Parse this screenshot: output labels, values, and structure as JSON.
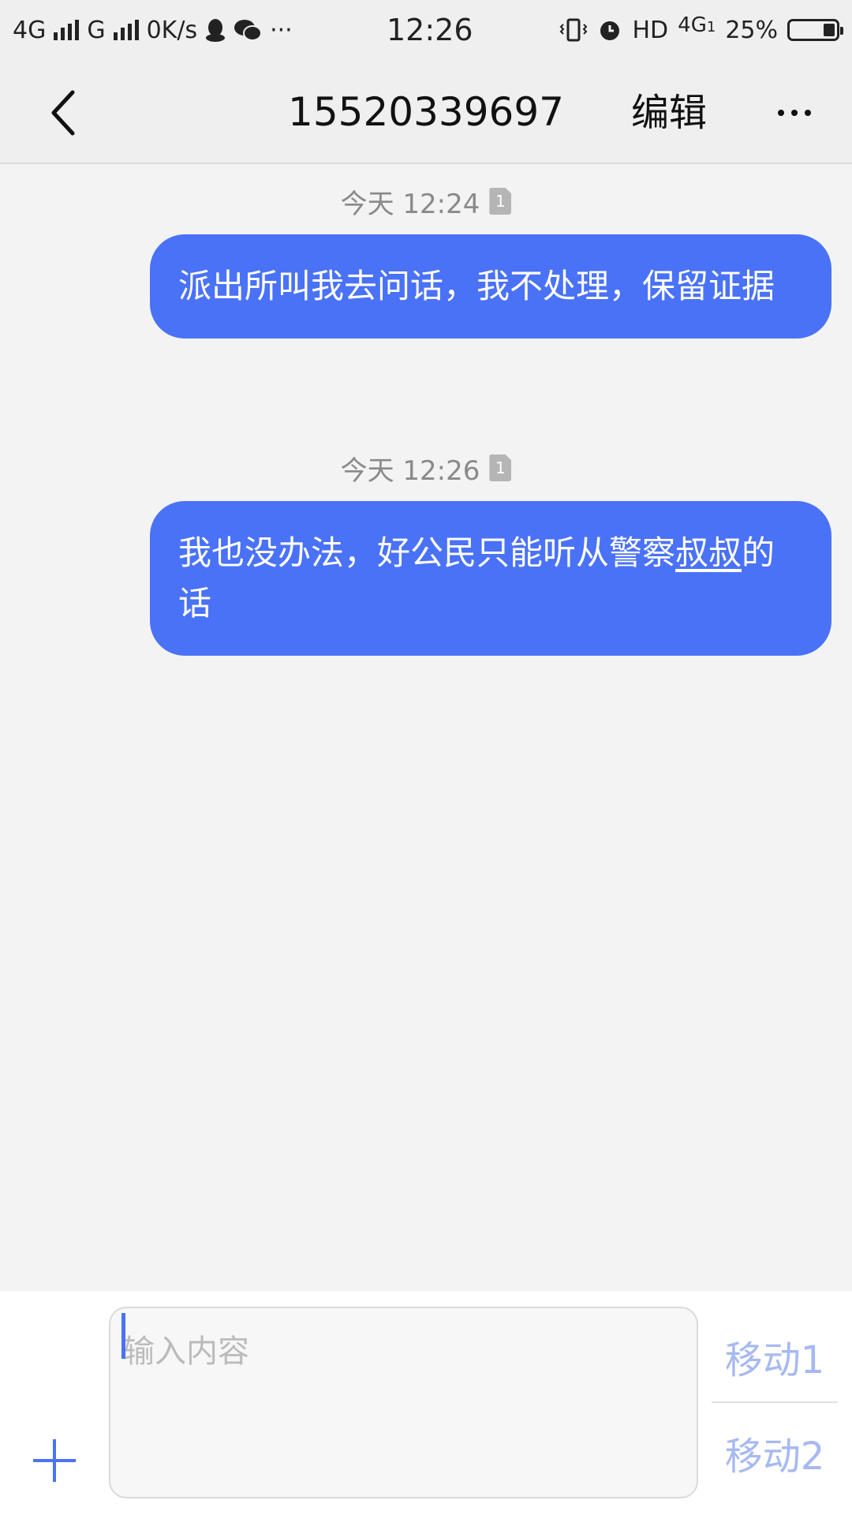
{
  "status_bar": {
    "network1": "4G",
    "network2": "G",
    "speed": "0K/s",
    "time": "12:26",
    "hd": "HD",
    "lte": "4G",
    "lte_sub": "1",
    "battery_percent": "25%",
    "battery_level": 0.25
  },
  "nav": {
    "title": "15520339697",
    "edit_label": "编辑"
  },
  "messages": [
    {
      "timestamp": "今天 12:24",
      "sim": "1",
      "text": "派出所叫我去问话，我不处理，保留证据"
    },
    {
      "timestamp": "今天 12:26",
      "sim": "1",
      "text_a": "我也没办法，好公民只能听从警察",
      "text_b": "叔叔",
      "text_c": "的话"
    }
  ],
  "composer": {
    "placeholder": "输入内容",
    "send_sim1_label": "移动1",
    "send_sim2_label": "移动2"
  },
  "colors": {
    "bubble": "#4a72f7",
    "background": "#f3f3f3",
    "send_label": "#a7b9f2"
  }
}
